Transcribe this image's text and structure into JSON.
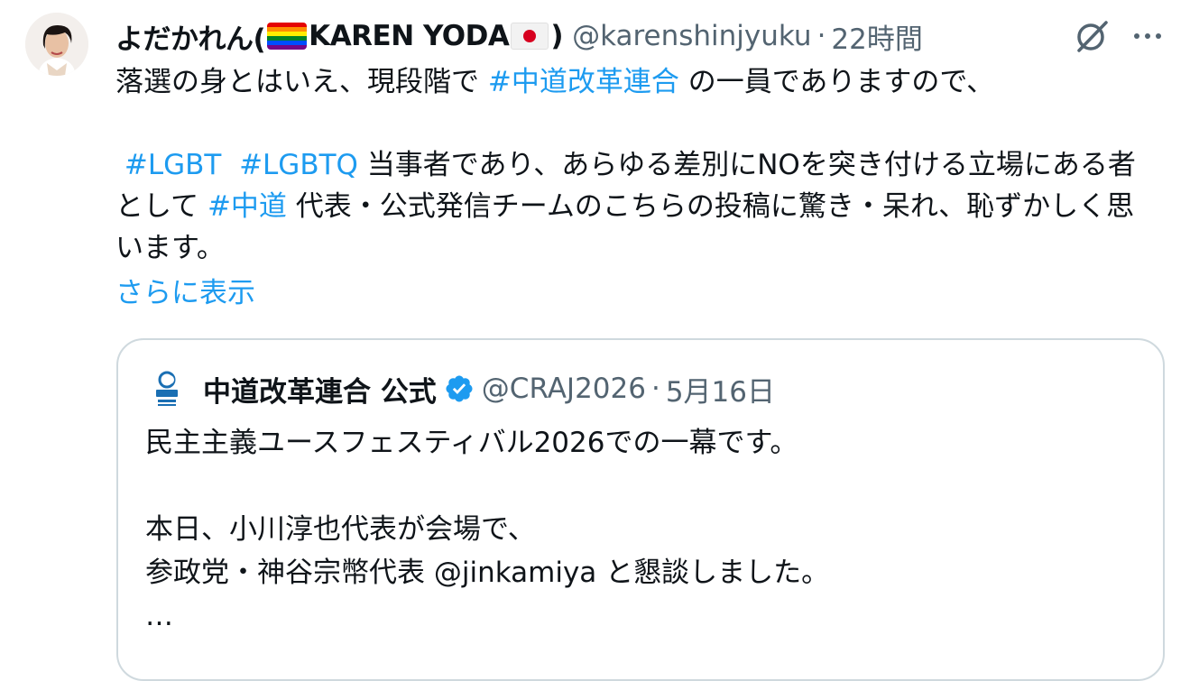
{
  "author": {
    "name_prefix": "よだかれん(",
    "name_main": "KAREN YODA",
    "name_suffix": ")",
    "flag_emoji_1": "rainbow-flag",
    "flag_emoji_2": "japan-flag",
    "handle": "@karenshinjyuku",
    "separator": "·",
    "time": "22時間"
  },
  "tweet": {
    "line1_pre": "落選の身とはいえ、現段階で ",
    "hashtag1": "#中道改革連合",
    "line1_post": " の一員でありますので、",
    "hashtag2": "#LGBT",
    "hashtag3": "#LGBTQ",
    "line3_a": " 当事者であり、あらゆる差別にNOを突き付ける立場にある者として ",
    "hashtag4": "#中道",
    "line3_b": " 代表・公式発信チームのこちらの投稿に驚き・呆れ、恥ずかしく思います。",
    "show_more": "さらに表示"
  },
  "quote": {
    "name": "中道改革連合 公式",
    "handle": "@CRAJ2026",
    "separator": "·",
    "time": "5月16日",
    "line1": "民主主義ユースフェスティバル2026での一幕です。",
    "line2": "本日、小川淳也代表が会場で、",
    "line3": "参政党・神谷宗幣代表 @jinkamiya と懇談しました。",
    "line4": "…"
  },
  "icons": {
    "grok": "grok-icon",
    "more": "more-icon",
    "verified": "verified-badge-icon",
    "logo": "party-logo-icon"
  },
  "colors": {
    "link": "#1d9bf0",
    "secondary": "#536471",
    "verified": "#1d9bf0"
  }
}
